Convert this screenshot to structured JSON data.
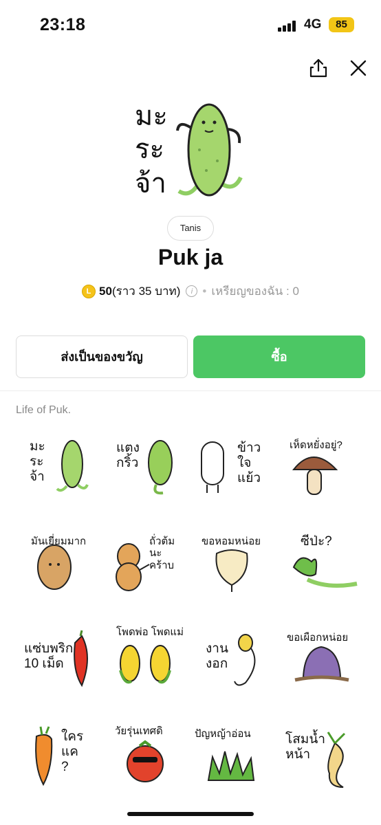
{
  "status": {
    "time": "23:18",
    "network": "4G",
    "battery": "85"
  },
  "header": {
    "share_icon": "share-icon",
    "close_icon": "close-icon"
  },
  "product": {
    "main_caption": [
      "มะ",
      "ระ",
      "จ้า"
    ],
    "author": "Tanis",
    "title": "Puk ja",
    "price": "50",
    "price_note": "(ราว 35 บาท)",
    "my_coins": "เหรียญของฉัน : 0"
  },
  "actions": {
    "gift_label": "ส่งเป็นของขวัญ",
    "buy_label": "ซื้อ"
  },
  "section": {
    "label": "Life of Puk."
  },
  "stickers": [
    {
      "caption": "มะ\nระ\nจ้า"
    },
    {
      "caption": "แตง\nกริ้ว"
    },
    {
      "caption": "ข้าว\nใจ\nแย้ว"
    },
    {
      "caption": "เห็ดหยั่งอยู่?"
    },
    {
      "caption": "มันเยี่ยมมาก"
    },
    {
      "caption": "ถั่วต้ม\nนะ\nคร้าบ"
    },
    {
      "caption": "ขอหอมหน่อย"
    },
    {
      "caption": "ซีป่ะ?"
    },
    {
      "caption": "แซ่บพริก\n10 เม็ด"
    },
    {
      "caption": "โพดพ่อ โพดแม่"
    },
    {
      "caption": "งาน\nงอก"
    },
    {
      "caption": "ขอเผือกหน่อย"
    },
    {
      "caption": "ใคร\nแค\n?"
    },
    {
      "caption": "วัยรุ่นเทศดิ"
    },
    {
      "caption": "ปัญหญ้าอ่อน"
    },
    {
      "caption": "โสมน้ำ\nหน้า"
    }
  ],
  "colors": {
    "buy_green": "#4cc764",
    "coin_yellow": "#f5c31a",
    "battery_yellow": "#f2c516"
  }
}
